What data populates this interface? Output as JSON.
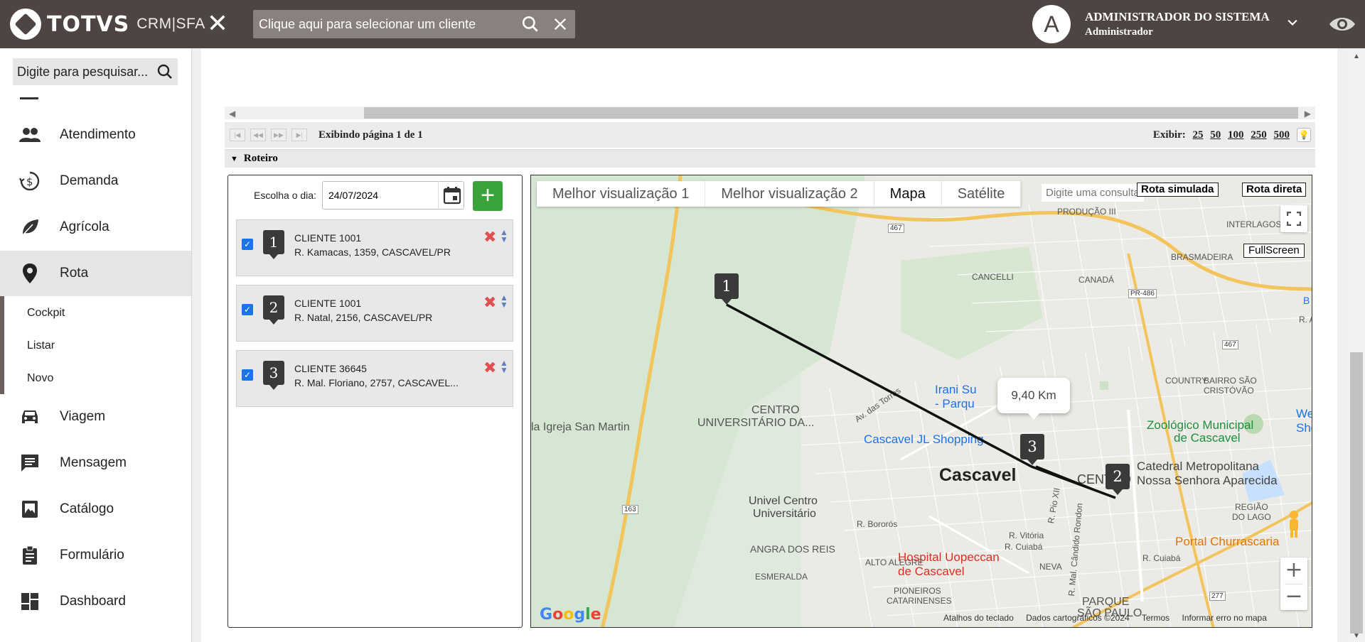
{
  "app": {
    "logo_text": "TOTVS",
    "logo_sub": "CRM|SFA",
    "client_search_placeholder": "Clique aqui para selecionar um cliente",
    "user_initial": "A",
    "user_name": "ADMINISTRADOR DO SISTEMA",
    "user_role": "Administrador"
  },
  "sidebar": {
    "search_placeholder": "Digite para pesquisar...",
    "items": [
      {
        "label": "Atendimento",
        "icon": "people-icon"
      },
      {
        "label": "Demanda",
        "icon": "money-cycle-icon"
      },
      {
        "label": "Agrícola",
        "icon": "leaf-icon"
      },
      {
        "label": "Rota",
        "icon": "location-pin-icon"
      },
      {
        "label": "Viagem",
        "icon": "car-icon"
      },
      {
        "label": "Mensagem",
        "icon": "message-icon"
      },
      {
        "label": "Catálogo",
        "icon": "image-book-icon"
      },
      {
        "label": "Formulário",
        "icon": "clipboard-icon"
      },
      {
        "label": "Dashboard",
        "icon": "dashboard-icon"
      }
    ],
    "submenu": [
      "Cockpit",
      "Listar",
      "Novo"
    ]
  },
  "pager": {
    "info": "Exibindo página 1 de 1",
    "exibir_label": "Exibir:",
    "sizes": [
      "25",
      "50",
      "100",
      "250",
      "500"
    ]
  },
  "section": {
    "title": "Roteiro"
  },
  "route": {
    "date_label": "Escolha o dia:",
    "date_value": "24/07/2024",
    "stops": [
      {
        "num": "1",
        "name": "CLIENTE 1001",
        "address": "R. Kamacas, 1359, CASCAVEL/PR",
        "checked": true
      },
      {
        "num": "2",
        "name": "CLIENTE 1001",
        "address": "R. Natal, 2156, CASCAVEL/PR",
        "checked": true
      },
      {
        "num": "3",
        "name": "CLIENTE 36645",
        "address": "R. Mal. Floriano, 2757, CASCAVEL...",
        "checked": true
      }
    ]
  },
  "map": {
    "tabs": [
      "Melhor visualização 1",
      "Melhor visualização 2",
      "Mapa",
      "Satélite"
    ],
    "selected_tab": "Mapa",
    "query_placeholder": "Digite uma consulta",
    "btn_simulada": "Rota simulada",
    "btn_direta": "Rota direta",
    "btn_fullscreen": "FullScreen",
    "distance": "9,40 Km",
    "footer": [
      "Atalhos do teclado",
      "Dados cartográficos ©2024",
      "Termos",
      "Informar erro no mapa"
    ],
    "google": "Google",
    "places": {
      "city": "Cascavel",
      "centro": "CENTRO",
      "cancelli": "CANCELLI",
      "canada": "CANADÁ",
      "brasmadeira": "BRASMADEIRA",
      "interlagos": "INTERLAGOS",
      "country": "COUNTRY",
      "bairro": "BAIRRO SÃO",
      "bairro2": "CRISTÓVÃO",
      "angra": "ANGRA DOS REIS",
      "esmeralda": "ESMERALDA",
      "alto": "ALTO ALEGRE",
      "neva": "NEVA",
      "pioneiros": "PIONEIROS",
      "pioneiros2": "CATARINENSES",
      "parque": "PARQUE",
      "parque2": "SÃO PAULO",
      "regiao": "REGIÃO",
      "regiao2": "DO LAGO",
      "producao": "PRODUÇÃO III",
      "irani": "Irani Su",
      "irani2": "- Parqu",
      "centro_univ": "CENTRO",
      "centro_univ2": "UNIVERSITÁRIO DA...",
      "igreja": "la Igreja San Martin",
      "shopping": "Cascavel JL Shopping",
      "catedral": "Catedral Metropolitana",
      "catedral2": "Nossa Senhora Aparecida",
      "zoo": "Zoológico Municipal",
      "zoo2": "de Cascavel",
      "univel": "Univel Centro",
      "univel2": "Universitário",
      "hospital": "Hospital Uopeccan",
      "hospital2": "de Cascavel",
      "churrascaria": "Portal Churrascaria",
      "we": "We",
      "sho": "Sho",
      "r_bororos": "R. Bororós",
      "r_vitoria": "R. Vitória",
      "r_cuiaba": "R. Cuiabá",
      "r_cuiaba2": "R. Cuiabá",
      "r_pio": "R. Pio XII",
      "r_candido": "R. Mal. Cândido Rondon",
      "av_torres": "Av. das Torres",
      "r_a": "R. A",
      "road_467": "467",
      "road_467b": "467",
      "road_163": "163",
      "road_277": "277",
      "road_pr486": "PR-486",
      "b_letter": "B"
    }
  }
}
